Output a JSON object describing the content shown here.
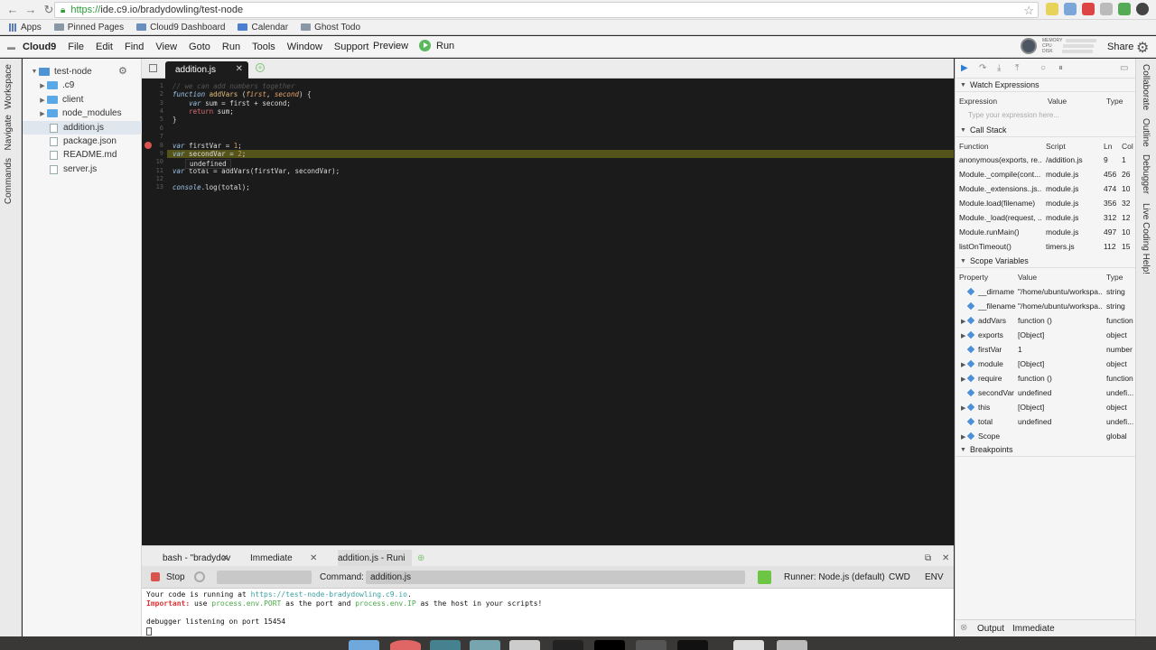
{
  "browser": {
    "url_scheme": "https://",
    "url_rest": "ide.c9.io/bradydowling/test-node",
    "bookmarks": [
      "Apps",
      "Pinned Pages",
      "Cloud9 Dashboard",
      "Calendar",
      "Ghost Todo"
    ]
  },
  "menubar": {
    "brand": "Cloud9",
    "items": [
      "File",
      "Edit",
      "Find",
      "View",
      "Goto",
      "Run",
      "Tools",
      "Window",
      "Support"
    ],
    "preview": "Preview",
    "run": "Run",
    "meters": [
      "MEMORY",
      "CPU",
      "DISK"
    ],
    "share": "Share"
  },
  "left_tabs": [
    "Workspace",
    "Navigate",
    "Commands"
  ],
  "tree": {
    "root": "test-node",
    "items": [
      {
        "name": ".c9",
        "type": "folder"
      },
      {
        "name": "client",
        "type": "folder"
      },
      {
        "name": "node_modules",
        "type": "folder"
      },
      {
        "name": "addition.js",
        "type": "file",
        "selected": true
      },
      {
        "name": "package.json",
        "type": "file"
      },
      {
        "name": "README.md",
        "type": "file"
      },
      {
        "name": "server.js",
        "type": "file"
      }
    ]
  },
  "editor": {
    "tab": "addition.js",
    "lines": [
      "1",
      "2",
      "3",
      "4",
      "5",
      "6",
      "7",
      "8",
      "9",
      "10",
      "11",
      "12",
      "13"
    ],
    "tooltip": "undefined"
  },
  "debugger": {
    "watch_title": "Watch Expressions",
    "watch_cols": [
      "Expression",
      "Value",
      "Type"
    ],
    "watch_placeholder": "Type your expression here...",
    "callstack_title": "Call Stack",
    "callstack_cols": [
      "Function",
      "Script",
      "Ln",
      "Col"
    ],
    "callstack": [
      {
        "fn": "anonymous(exports, re...",
        "script": "/addition.js",
        "ln": "9",
        "col": "1"
      },
      {
        "fn": "Module._compile(cont...",
        "script": "module.js",
        "ln": "456",
        "col": "26"
      },
      {
        "fn": "Module._extensions..js...",
        "script": "module.js",
        "ln": "474",
        "col": "10"
      },
      {
        "fn": "Module.load(filename)",
        "script": "module.js",
        "ln": "356",
        "col": "32"
      },
      {
        "fn": "Module._load(request, ...",
        "script": "module.js",
        "ln": "312",
        "col": "12"
      },
      {
        "fn": "Module.runMain()",
        "script": "module.js",
        "ln": "497",
        "col": "10"
      },
      {
        "fn": "listOnTimeout()",
        "script": "timers.js",
        "ln": "112",
        "col": "15"
      }
    ],
    "scope_title": "Scope Variables",
    "scope_cols": [
      "Property",
      "Value",
      "Type"
    ],
    "scope": [
      {
        "prop": "__dirname",
        "val": "\"/home/ubuntu/workspa...",
        "type": "string",
        "expand": false
      },
      {
        "prop": "__filename",
        "val": "\"/home/ubuntu/workspa...",
        "type": "string",
        "expand": false
      },
      {
        "prop": "addVars",
        "val": "function ()",
        "type": "function",
        "expand": true
      },
      {
        "prop": "exports",
        "val": "[Object]",
        "type": "object",
        "expand": true
      },
      {
        "prop": "firstVar",
        "val": "1",
        "type": "number",
        "expand": false
      },
      {
        "prop": "module",
        "val": "[Object]",
        "type": "object",
        "expand": true
      },
      {
        "prop": "require",
        "val": "function ()",
        "type": "function",
        "expand": true
      },
      {
        "prop": "secondVar",
        "val": "undefined",
        "type": "undefi...",
        "expand": false
      },
      {
        "prop": "this",
        "val": "[Object]",
        "type": "object",
        "expand": true
      },
      {
        "prop": "total",
        "val": "undefined",
        "type": "undefi...",
        "expand": false
      },
      {
        "prop": "Scope",
        "val": "",
        "type": "global",
        "expand": true
      }
    ],
    "breakpoints_title": "Breakpoints",
    "bottom": [
      "Output",
      "Immediate"
    ]
  },
  "right_tabs": [
    "Collaborate",
    "Outline",
    "Debugger",
    "Live Coding Help!"
  ],
  "console": {
    "tabs": [
      "bash - \"bradydov",
      "Immediate",
      "addition.js - Runi"
    ],
    "stop": "Stop",
    "command_label": "Command:",
    "command_value": "addition.js",
    "runner": "Runner: Node.js (default)",
    "cwd": "CWD",
    "env": "ENV",
    "out1a": "Your code is running at ",
    "out1b": "https://test-node-bradydowling.c9.io",
    "out1c": ".",
    "out2a": "Important:",
    "out2b": " use ",
    "out2c": "process.env.PORT",
    "out2d": " as the port and ",
    "out2e": "process.env.IP",
    "out2f": " as the host in your scripts!",
    "out3": "debugger listening on port 15454"
  }
}
